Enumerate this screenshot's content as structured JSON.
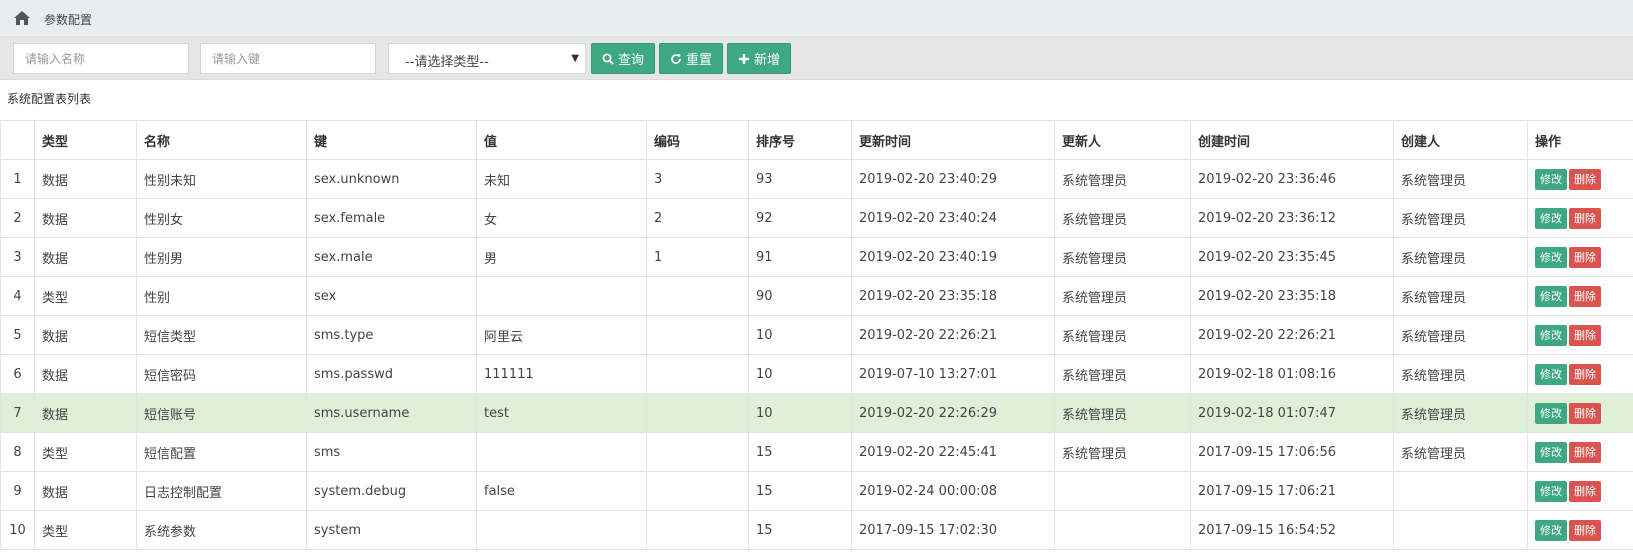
{
  "breadcrumb": {
    "label": "参数配置"
  },
  "toolbar": {
    "name_placeholder": "请输入名称",
    "key_placeholder": "请输入键",
    "type_select_value": "--请选择类型--",
    "query_label": "查询",
    "reset_label": "重置",
    "add_label": "新增"
  },
  "section_title": "系统配置表列表",
  "table": {
    "headers": [
      "",
      "类型",
      "名称",
      "键",
      "值",
      "编码",
      "排序号",
      "更新时间",
      "更新人",
      "创建时间",
      "创建人",
      "操作"
    ],
    "edit_label": "修改",
    "delete_label": "删除",
    "highlighted_row": 7,
    "rows": [
      [
        "1",
        "数据",
        "性别未知",
        "sex.unknown",
        "未知",
        "3",
        "93",
        "2019-02-20 23:40:29",
        "系统管理员",
        "2019-02-20 23:36:46",
        "系统管理员"
      ],
      [
        "2",
        "数据",
        "性别女",
        "sex.female",
        "女",
        "2",
        "92",
        "2019-02-20 23:40:24",
        "系统管理员",
        "2019-02-20 23:36:12",
        "系统管理员"
      ],
      [
        "3",
        "数据",
        "性别男",
        "sex.male",
        "男",
        "1",
        "91",
        "2019-02-20 23:40:19",
        "系统管理员",
        "2019-02-20 23:35:45",
        "系统管理员"
      ],
      [
        "4",
        "类型",
        "性别",
        "sex",
        "",
        "",
        "90",
        "2019-02-20 23:35:18",
        "系统管理员",
        "2019-02-20 23:35:18",
        "系统管理员"
      ],
      [
        "5",
        "数据",
        "短信类型",
        "sms.type",
        "阿里云",
        "",
        "10",
        "2019-02-20 22:26:21",
        "系统管理员",
        "2019-02-20 22:26:21",
        "系统管理员"
      ],
      [
        "6",
        "数据",
        "短信密码",
        "sms.passwd",
        "111111",
        "",
        "10",
        "2019-07-10 13:27:01",
        "系统管理员",
        "2019-02-18 01:08:16",
        "系统管理员"
      ],
      [
        "7",
        "数据",
        "短信账号",
        "sms.username",
        "test",
        "",
        "10",
        "2019-02-20 22:26:29",
        "系统管理员",
        "2019-02-18 01:07:47",
        "系统管理员"
      ],
      [
        "8",
        "类型",
        "短信配置",
        "sms",
        "",
        "",
        "15",
        "2019-02-20 22:45:41",
        "系统管理员",
        "2017-09-15 17:06:56",
        "系统管理员"
      ],
      [
        "9",
        "数据",
        "日志控制配置",
        "system.debug",
        "false",
        "",
        "15",
        "2019-02-24 00:00:08",
        "",
        "2017-09-15 17:06:21",
        ""
      ],
      [
        "10",
        "类型",
        "系统参数",
        "system",
        "",
        "",
        "15",
        "2017-09-15 17:02:30",
        "",
        "2017-09-15 16:54:52",
        ""
      ]
    ]
  },
  "colors": {
    "accent": "#3ea883",
    "danger": "#d9534f",
    "highlight": "#dff0d8",
    "header_bg": "#e9edf3"
  }
}
